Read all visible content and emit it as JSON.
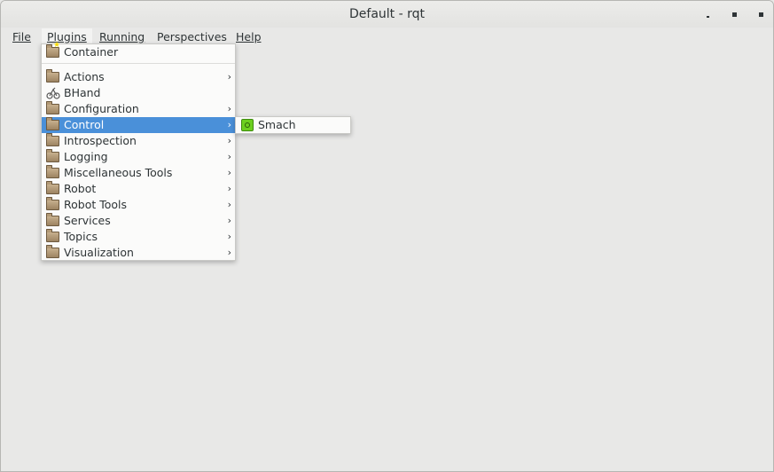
{
  "window": {
    "title": "Default - rqt",
    "controls": {
      "minimize": "minimize-icon",
      "maximize": "maximize-icon",
      "close": "close-icon"
    }
  },
  "menubar": {
    "items": [
      {
        "label": "File",
        "mnemonic_index": 0
      },
      {
        "label": "Plugins",
        "mnemonic_index": 0
      },
      {
        "label": "Running",
        "mnemonic_index": 0
      },
      {
        "label": "Perspectives",
        "mnemonic_index": 1
      },
      {
        "label": "Help",
        "mnemonic_index": 0
      }
    ],
    "active": "Plugins"
  },
  "plugins_menu": {
    "items": [
      {
        "label": "Container",
        "icon": "folder-star-icon",
        "submenu": false
      },
      {
        "label": "Actions",
        "icon": "folder-icon",
        "submenu": true
      },
      {
        "label": "BHand",
        "icon": "robot-hand-icon",
        "submenu": false
      },
      {
        "label": "Configuration",
        "icon": "folder-icon",
        "submenu": true
      },
      {
        "label": "Control",
        "icon": "folder-icon",
        "submenu": true
      },
      {
        "label": "Introspection",
        "icon": "folder-icon",
        "submenu": true
      },
      {
        "label": "Logging",
        "icon": "folder-icon",
        "submenu": true
      },
      {
        "label": "Miscellaneous Tools",
        "icon": "folder-icon",
        "submenu": true
      },
      {
        "label": "Robot",
        "icon": "folder-icon",
        "submenu": true
      },
      {
        "label": "Robot Tools",
        "icon": "folder-icon",
        "submenu": true
      },
      {
        "label": "Services",
        "icon": "folder-icon",
        "submenu": true
      },
      {
        "label": "Topics",
        "icon": "folder-icon",
        "submenu": true
      },
      {
        "label": "Visualization",
        "icon": "folder-icon",
        "submenu": true
      }
    ],
    "highlighted": "Control",
    "submenu_arrow": "›"
  },
  "control_submenu": {
    "items": [
      {
        "label": "Smach",
        "icon": "smach-plugin-icon"
      }
    ]
  },
  "colors": {
    "selection": "#4a90d9",
    "background": "#e8e8e7",
    "menu_background": "#fbfbfa",
    "text": "#2e3436"
  }
}
